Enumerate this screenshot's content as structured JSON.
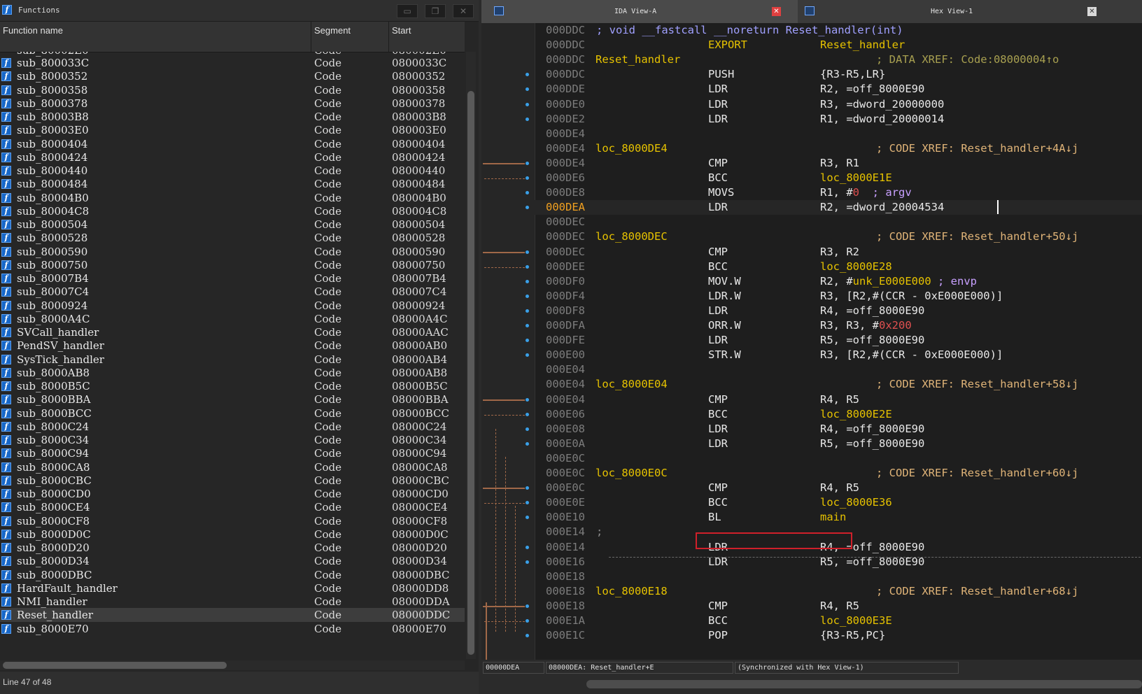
{
  "functions_window": {
    "title": "Functions",
    "columns": [
      "Function name",
      "Segment",
      "Start"
    ],
    "partial_top_row": {
      "name": "sub_80002E0",
      "segment": "Code",
      "start": "080002E0"
    },
    "rows": [
      {
        "name": "sub_800033C",
        "segment": "Code",
        "start": "0800033C"
      },
      {
        "name": "sub_8000352",
        "segment": "Code",
        "start": "08000352"
      },
      {
        "name": "sub_8000358",
        "segment": "Code",
        "start": "08000358"
      },
      {
        "name": "sub_8000378",
        "segment": "Code",
        "start": "08000378"
      },
      {
        "name": "sub_80003B8",
        "segment": "Code",
        "start": "080003B8"
      },
      {
        "name": "sub_80003E0",
        "segment": "Code",
        "start": "080003E0"
      },
      {
        "name": "sub_8000404",
        "segment": "Code",
        "start": "08000404"
      },
      {
        "name": "sub_8000424",
        "segment": "Code",
        "start": "08000424"
      },
      {
        "name": "sub_8000440",
        "segment": "Code",
        "start": "08000440"
      },
      {
        "name": "sub_8000484",
        "segment": "Code",
        "start": "08000484"
      },
      {
        "name": "sub_80004B0",
        "segment": "Code",
        "start": "080004B0"
      },
      {
        "name": "sub_80004C8",
        "segment": "Code",
        "start": "080004C8"
      },
      {
        "name": "sub_8000504",
        "segment": "Code",
        "start": "08000504"
      },
      {
        "name": "sub_8000528",
        "segment": "Code",
        "start": "08000528"
      },
      {
        "name": "sub_8000590",
        "segment": "Code",
        "start": "08000590"
      },
      {
        "name": "sub_8000750",
        "segment": "Code",
        "start": "08000750"
      },
      {
        "name": "sub_80007B4",
        "segment": "Code",
        "start": "080007B4"
      },
      {
        "name": "sub_80007C4",
        "segment": "Code",
        "start": "080007C4"
      },
      {
        "name": "sub_8000924",
        "segment": "Code",
        "start": "08000924"
      },
      {
        "name": "sub_8000A4C",
        "segment": "Code",
        "start": "08000A4C"
      },
      {
        "name": "SVCall_handler",
        "segment": "Code",
        "start": "08000AAC"
      },
      {
        "name": "PendSV_handler",
        "segment": "Code",
        "start": "08000AB0"
      },
      {
        "name": "SysTick_handler",
        "segment": "Code",
        "start": "08000AB4"
      },
      {
        "name": "sub_8000AB8",
        "segment": "Code",
        "start": "08000AB8"
      },
      {
        "name": "sub_8000B5C",
        "segment": "Code",
        "start": "08000B5C"
      },
      {
        "name": "sub_8000BBA",
        "segment": "Code",
        "start": "08000BBA"
      },
      {
        "name": "sub_8000BCC",
        "segment": "Code",
        "start": "08000BCC"
      },
      {
        "name": "sub_8000C24",
        "segment": "Code",
        "start": "08000C24"
      },
      {
        "name": "sub_8000C34",
        "segment": "Code",
        "start": "08000C34"
      },
      {
        "name": "sub_8000C94",
        "segment": "Code",
        "start": "08000C94"
      },
      {
        "name": "sub_8000CA8",
        "segment": "Code",
        "start": "08000CA8"
      },
      {
        "name": "sub_8000CBC",
        "segment": "Code",
        "start": "08000CBC"
      },
      {
        "name": "sub_8000CD0",
        "segment": "Code",
        "start": "08000CD0"
      },
      {
        "name": "sub_8000CE4",
        "segment": "Code",
        "start": "08000CE4"
      },
      {
        "name": "sub_8000CF8",
        "segment": "Code",
        "start": "08000CF8"
      },
      {
        "name": "sub_8000D0C",
        "segment": "Code",
        "start": "08000D0C"
      },
      {
        "name": "sub_8000D20",
        "segment": "Code",
        "start": "08000D20"
      },
      {
        "name": "sub_8000D34",
        "segment": "Code",
        "start": "08000D34"
      },
      {
        "name": "sub_8000DBC",
        "segment": "Code",
        "start": "08000DBC"
      },
      {
        "name": "HardFault_handler",
        "segment": "Code",
        "start": "08000DD8"
      },
      {
        "name": "NMI_handler",
        "segment": "Code",
        "start": "08000DDA"
      },
      {
        "name": "Reset_handler",
        "segment": "Code",
        "start": "08000DDC",
        "selected": true
      },
      {
        "name": "sub_8000E70",
        "segment": "Code",
        "start": "08000E70"
      }
    ],
    "status": "Line 47 of 48"
  },
  "tabs": [
    {
      "label": "IDA View-A",
      "active": true
    },
    {
      "label": "Hex View-1",
      "active": false
    }
  ],
  "ida_view": {
    "lines": [
      {
        "addr": "000DDC",
        "comment": "; void __fastcall __noreturn Reset_handler(int)"
      },
      {
        "addr": "000DDC",
        "mnemonic": "EXPORT",
        "operand": "Reset_handler",
        "mn_color": "#e6c200",
        "op_color": "#e6c200"
      },
      {
        "addr": "000DDC",
        "label": "Reset_handler",
        "xref": "; DATA XREF: Code:08000004↑o",
        "xref_color": "#a8a050"
      },
      {
        "addr": "000DDC",
        "mnemonic": "PUSH",
        "operand": "{R3-R5,LR}",
        "dot": true
      },
      {
        "addr": "000DDE",
        "mnemonic": "LDR",
        "operand": "R2, =off_8000E90",
        "dot": true
      },
      {
        "addr": "000DE0",
        "mnemonic": "LDR",
        "operand": "R3, =dword_20000000",
        "dot": true
      },
      {
        "addr": "000DE2",
        "mnemonic": "LDR",
        "operand": "R1, =dword_20000014",
        "dot": true
      },
      {
        "addr": "000DE4"
      },
      {
        "addr": "000DE4",
        "label": "loc_8000DE4",
        "xref": "; CODE XREF: Reset_handler+4A↓j"
      },
      {
        "addr": "000DE4",
        "mnemonic": "CMP",
        "operand": "R3, R1",
        "dot": true,
        "arrow_in": true
      },
      {
        "addr": "000DE6",
        "mnemonic": "BCC",
        "operand_label": "loc_8000E1E",
        "dot": true
      },
      {
        "addr": "000DE8",
        "mnemonic": "MOVS",
        "operand": "R1, #",
        "imm": "0",
        "tail": "  ; argv",
        "dot": true
      },
      {
        "addr": "000DEA",
        "mnemonic": "LDR",
        "operand": "R2, =dword_20004534",
        "dot": true,
        "current": true
      },
      {
        "addr": "000DEC"
      },
      {
        "addr": "000DEC",
        "label": "loc_8000DEC",
        "xref": "; CODE XREF: Reset_handler+50↓j"
      },
      {
        "addr": "000DEC",
        "mnemonic": "CMP",
        "operand": "R3, R2",
        "dot": true,
        "arrow_in": true
      },
      {
        "addr": "000DEE",
        "mnemonic": "BCC",
        "operand_label": "loc_8000E28",
        "dot": true
      },
      {
        "addr": "000DF0",
        "mnemonic": "MOV.W",
        "operand": "R2, #",
        "imm_label": "unk_E000E000",
        "tail": " ; envp",
        "dot": true
      },
      {
        "addr": "000DF4",
        "mnemonic": "LDR.W",
        "operand": "R3, [R2,#(CCR - 0xE000E000)]",
        "dot": true
      },
      {
        "addr": "000DF8",
        "mnemonic": "LDR",
        "operand": "R4, =off_8000E90",
        "dot": true
      },
      {
        "addr": "000DFA",
        "mnemonic": "ORR.W",
        "operand": "R3, R3, #",
        "imm": "0x200",
        "dot": true
      },
      {
        "addr": "000DFE",
        "mnemonic": "LDR",
        "operand": "R5, =off_8000E90",
        "dot": true
      },
      {
        "addr": "000E00",
        "mnemonic": "STR.W",
        "operand": "R3, [R2,#(CCR - 0xE000E000)]",
        "dot": true
      },
      {
        "addr": "000E04"
      },
      {
        "addr": "000E04",
        "label": "loc_8000E04",
        "xref": "; CODE XREF: Reset_handler+58↓j"
      },
      {
        "addr": "000E04",
        "mnemonic": "CMP",
        "operand": "R4, R5",
        "dot": true,
        "arrow_in": true
      },
      {
        "addr": "000E06",
        "mnemonic": "BCC",
        "operand_label": "loc_8000E2E",
        "dot": true
      },
      {
        "addr": "000E08",
        "mnemonic": "LDR",
        "operand": "R4, =off_8000E90",
        "dot": true
      },
      {
        "addr": "000E0A",
        "mnemonic": "LDR",
        "operand": "R5, =off_8000E90",
        "dot": true
      },
      {
        "addr": "000E0C"
      },
      {
        "addr": "000E0C",
        "label": "loc_8000E0C",
        "xref": "; CODE XREF: Reset_handler+60↓j"
      },
      {
        "addr": "000E0C",
        "mnemonic": "CMP",
        "operand": "R4, R5",
        "dot": true,
        "arrow_in": true
      },
      {
        "addr": "000E0E",
        "mnemonic": "BCC",
        "operand_label": "loc_8000E36",
        "dot": true
      },
      {
        "addr": "000E10",
        "mnemonic": "BL",
        "operand_label": "main",
        "dot": true,
        "boxed": true
      },
      {
        "addr": "000E14",
        "separator": ";"
      },
      {
        "addr": "000E14",
        "mnemonic": "LDR",
        "operand": "R4, =off_8000E90",
        "dot": true
      },
      {
        "addr": "000E16",
        "mnemonic": "LDR",
        "operand": "R5, =off_8000E90",
        "dot": true
      },
      {
        "addr": "000E18"
      },
      {
        "addr": "000E18",
        "label": "loc_8000E18",
        "xref": "; CODE XREF: Reset_handler+68↓j"
      },
      {
        "addr": "000E18",
        "mnemonic": "CMP",
        "operand": "R4, R5",
        "dot": true,
        "arrow_in": true
      },
      {
        "addr": "000E1A",
        "mnemonic": "BCC",
        "operand_label": "loc_8000E3E",
        "dot": true
      },
      {
        "addr": "000E1C",
        "mnemonic": "POP",
        "operand": "{R3-R5,PC}",
        "dot": true
      }
    ],
    "status": {
      "offset": "00000DEA",
      "location": "08000DEA: Reset_handler+E",
      "sync": "(Synchronized with Hex View-1)"
    }
  }
}
